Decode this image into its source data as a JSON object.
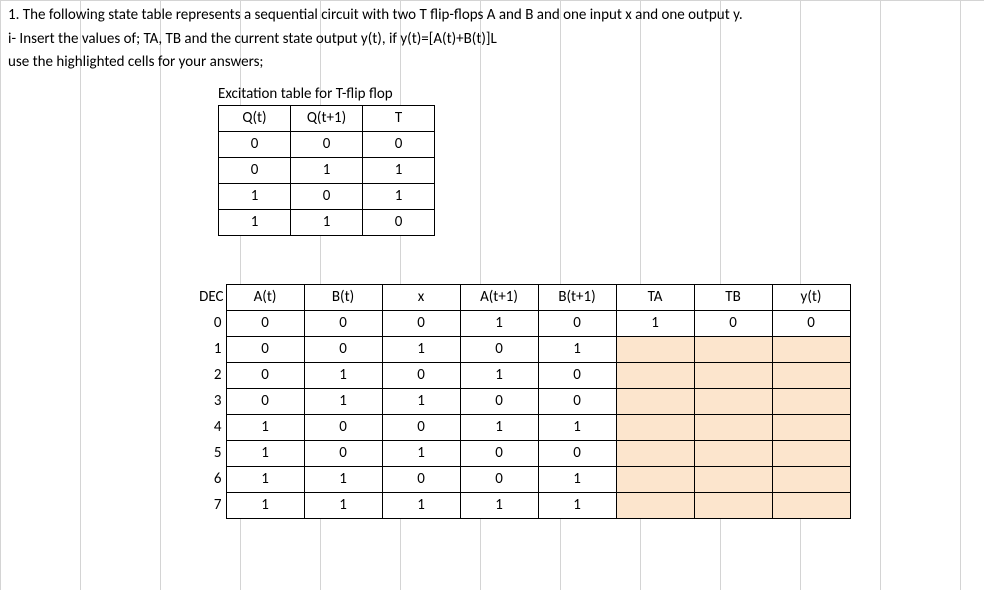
{
  "problem": {
    "line1": "1.    The following state table represents a sequential circuit with two T flip-flops A and B and one input x and one output y.",
    "line2": "i-  Insert the values of; TA, TB and the current state output y(t), if y(t)=[A(t)+B(t)]L",
    "line3": "use the highlighted cells for your answers;"
  },
  "excitation": {
    "title": "Excitation table for T-flip flop",
    "headers": [
      "Q(t)",
      "Q(t+1)",
      "T"
    ],
    "rows": [
      [
        "0",
        "0",
        "0"
      ],
      [
        "0",
        "1",
        "1"
      ],
      [
        "1",
        "0",
        "1"
      ],
      [
        "1",
        "1",
        "0"
      ]
    ]
  },
  "state_table": {
    "dec_header": "DEC",
    "headers": [
      "A(t)",
      "B(t)",
      "x",
      "A(t+1)",
      "B(t+1)",
      "TA",
      "TB",
      "y(t)"
    ],
    "rows": [
      {
        "dec": "0",
        "cells": [
          "0",
          "0",
          "0",
          "1",
          "0",
          "1",
          "0",
          "0"
        ],
        "highlight": []
      },
      {
        "dec": "1",
        "cells": [
          "0",
          "0",
          "1",
          "0",
          "1",
          "",
          "",
          ""
        ],
        "highlight": [
          5,
          6,
          7
        ]
      },
      {
        "dec": "2",
        "cells": [
          "0",
          "1",
          "0",
          "1",
          "0",
          "",
          "",
          ""
        ],
        "highlight": [
          5,
          6,
          7
        ]
      },
      {
        "dec": "3",
        "cells": [
          "0",
          "1",
          "1",
          "0",
          "0",
          "",
          "",
          ""
        ],
        "highlight": [
          5,
          6,
          7
        ]
      },
      {
        "dec": "4",
        "cells": [
          "1",
          "0",
          "0",
          "1",
          "1",
          "",
          "",
          ""
        ],
        "highlight": [
          5,
          6,
          7
        ]
      },
      {
        "dec": "5",
        "cells": [
          "1",
          "0",
          "1",
          "0",
          "0",
          "",
          "",
          ""
        ],
        "highlight": [
          5,
          6,
          7
        ]
      },
      {
        "dec": "6",
        "cells": [
          "1",
          "1",
          "0",
          "0",
          "1",
          "",
          "",
          ""
        ],
        "highlight": [
          5,
          6,
          7
        ]
      },
      {
        "dec": "7",
        "cells": [
          "1",
          "1",
          "1",
          "1",
          "1",
          "",
          "",
          ""
        ],
        "highlight": [
          5,
          6,
          7
        ]
      }
    ]
  },
  "chart_data": {
    "type": "table",
    "title": "State table for sequential circuit with T flip-flops",
    "excitation_table": {
      "columns": [
        "Q(t)",
        "Q(t+1)",
        "T"
      ],
      "data": [
        [
          0,
          0,
          0
        ],
        [
          0,
          1,
          1
        ],
        [
          1,
          0,
          1
        ],
        [
          1,
          1,
          0
        ]
      ]
    },
    "state_table": {
      "columns": [
        "DEC",
        "A(t)",
        "B(t)",
        "x",
        "A(t+1)",
        "B(t+1)",
        "TA",
        "TB",
        "y(t)"
      ],
      "data": [
        [
          0,
          0,
          0,
          0,
          1,
          0,
          1,
          0,
          0
        ],
        [
          1,
          0,
          0,
          1,
          0,
          1,
          null,
          null,
          null
        ],
        [
          2,
          0,
          1,
          0,
          1,
          0,
          null,
          null,
          null
        ],
        [
          3,
          0,
          1,
          1,
          0,
          0,
          null,
          null,
          null
        ],
        [
          4,
          1,
          0,
          0,
          1,
          1,
          null,
          null,
          null
        ],
        [
          5,
          1,
          0,
          1,
          0,
          0,
          null,
          null,
          null
        ],
        [
          6,
          1,
          1,
          0,
          0,
          1,
          null,
          null,
          null
        ],
        [
          7,
          1,
          1,
          1,
          1,
          1,
          null,
          null,
          null
        ]
      ]
    }
  }
}
